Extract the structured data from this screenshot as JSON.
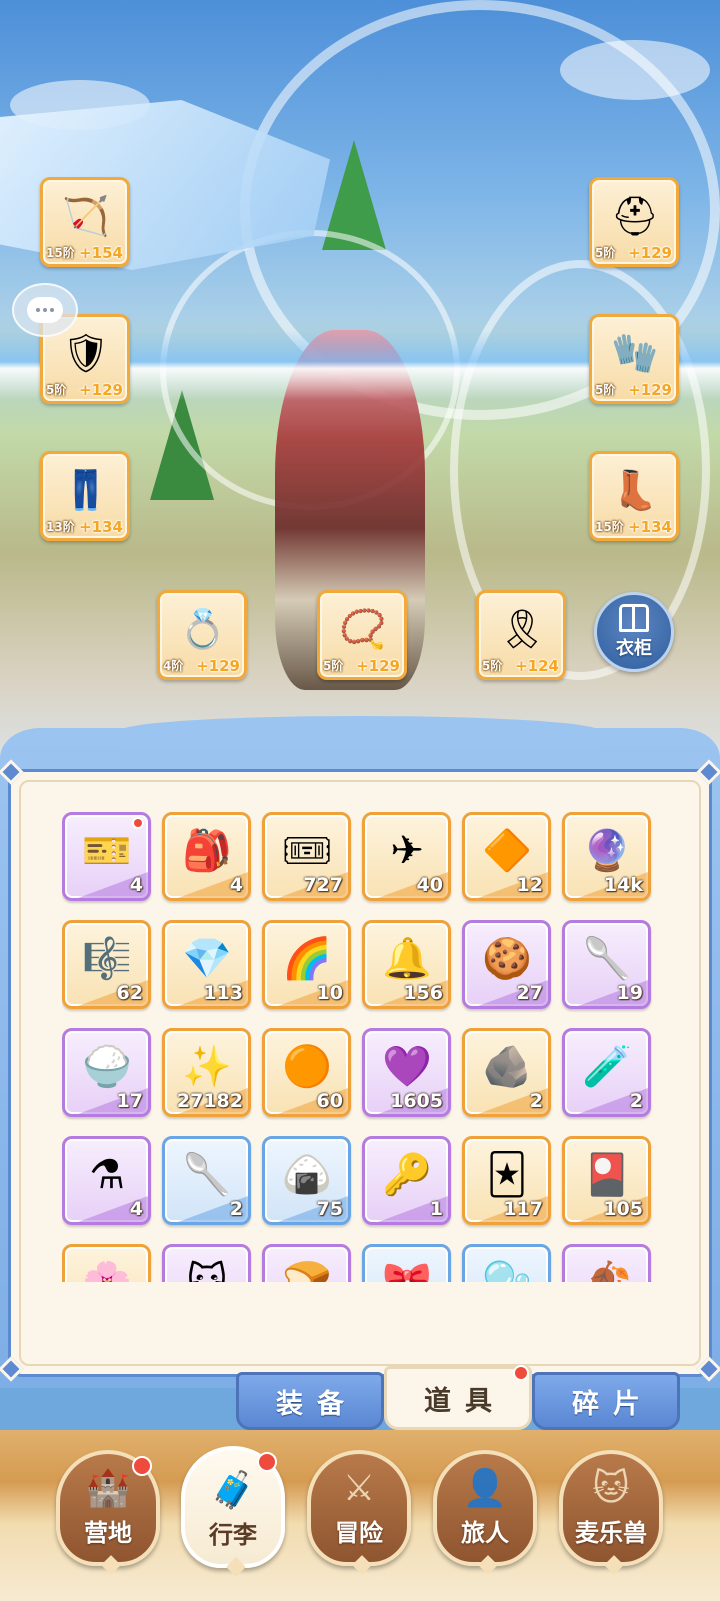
{
  "equipment": [
    {
      "slot": "weapon-bow",
      "icon": "bow-icon",
      "glyph": "🏹",
      "tier": "15阶",
      "bonus": "+154"
    },
    {
      "slot": "chest-armor",
      "icon": "armor-icon",
      "glyph": "🛡",
      "tier": "5阶",
      "bonus": "+129"
    },
    {
      "slot": "legs",
      "icon": "pants-icon",
      "glyph": "👖",
      "tier": "13阶",
      "bonus": "+134"
    },
    {
      "slot": "helmet",
      "icon": "helmet-icon",
      "glyph": "⛑",
      "tier": "5阶",
      "bonus": "+129"
    },
    {
      "slot": "gloves",
      "icon": "gloves-icon",
      "glyph": "🧤",
      "tier": "5阶",
      "bonus": "+129"
    },
    {
      "slot": "boots",
      "icon": "boots-icon",
      "glyph": "👢",
      "tier": "15阶",
      "bonus": "+134"
    },
    {
      "slot": "ring",
      "icon": "ring-icon",
      "glyph": "💍",
      "tier": "4阶",
      "bonus": "+129"
    },
    {
      "slot": "necklace",
      "icon": "necklace-icon",
      "glyph": "📿",
      "tier": "5阶",
      "bonus": "+129"
    },
    {
      "slot": "charm",
      "icon": "charm-icon",
      "glyph": "🎗",
      "tier": "5阶",
      "bonus": "+124"
    }
  ],
  "wardrobe": {
    "label": "衣柜"
  },
  "inventory": {
    "items": [
      {
        "icon": "ticket-card-icon",
        "glyph": "🎫",
        "count": "4",
        "rarity": "purple",
        "new": true
      },
      {
        "icon": "seed-bag-icon",
        "glyph": "🎒",
        "count": "4",
        "rarity": "orange",
        "new": false
      },
      {
        "icon": "purple-ticket-icon",
        "glyph": "🎟",
        "count": "727",
        "rarity": "orange",
        "new": false
      },
      {
        "icon": "paper-plane-icon",
        "glyph": "✈",
        "count": "40",
        "rarity": "orange",
        "new": false
      },
      {
        "icon": "gold-crystal-icon",
        "glyph": "🔶",
        "count": "12",
        "rarity": "orange",
        "new": false
      },
      {
        "icon": "orb-icon",
        "glyph": "🔮",
        "count": "14k",
        "rarity": "orange",
        "new": false
      },
      {
        "icon": "harp-icon",
        "glyph": "🎼",
        "count": "62",
        "rarity": "orange",
        "new": false
      },
      {
        "icon": "ice-crystal-icon",
        "glyph": "💎",
        "count": "113",
        "rarity": "orange",
        "new": false
      },
      {
        "icon": "rainbow-tube-icon",
        "glyph": "🌈",
        "count": "10",
        "rarity": "orange",
        "new": false
      },
      {
        "icon": "bell-icon",
        "glyph": "🔔",
        "count": "156",
        "rarity": "orange",
        "new": false
      },
      {
        "icon": "cookie-plate-icon",
        "glyph": "🍪",
        "count": "27",
        "rarity": "purple",
        "new": false
      },
      {
        "icon": "cat-spoon-icon",
        "glyph": "🥄",
        "count": "19",
        "rarity": "purple",
        "new": false
      },
      {
        "icon": "flour-sack-icon",
        "glyph": "🍚",
        "count": "17",
        "rarity": "purple",
        "new": false
      },
      {
        "icon": "star-crystal-icon",
        "glyph": "✨",
        "count": "27182",
        "rarity": "orange",
        "new": false
      },
      {
        "icon": "amber-gem-icon",
        "glyph": "🟠",
        "count": "60",
        "rarity": "orange",
        "new": false
      },
      {
        "icon": "heart-coin-icon",
        "glyph": "💜",
        "count": "1605",
        "rarity": "purple",
        "new": false
      },
      {
        "icon": "ore-icon",
        "glyph": "🪨",
        "count": "2",
        "rarity": "orange",
        "new": false
      },
      {
        "icon": "blue-potion-icon",
        "glyph": "🧪",
        "count": "2",
        "rarity": "purple",
        "new": false
      },
      {
        "icon": "red-potion-icon",
        "glyph": "⚗",
        "count": "4",
        "rarity": "purple",
        "new": false
      },
      {
        "icon": "paw-spoon-icon",
        "glyph": "🥄",
        "count": "2",
        "rarity": "blue",
        "new": false
      },
      {
        "icon": "rice-bowl-icon",
        "glyph": "🍙",
        "count": "75",
        "rarity": "blue",
        "new": false
      },
      {
        "icon": "gold-key-icon",
        "glyph": "🔑",
        "count": "1",
        "rarity": "purple",
        "new": false
      },
      {
        "icon": "gold-card-icon",
        "glyph": "🃏",
        "count": "117",
        "rarity": "orange",
        "new": false
      },
      {
        "icon": "red-card-icon",
        "glyph": "🎴",
        "count": "105",
        "rarity": "orange",
        "new": false
      },
      {
        "icon": "pink-item-icon",
        "glyph": "🌸",
        "count": "",
        "rarity": "orange",
        "new": false
      },
      {
        "icon": "cat-mask-icon",
        "glyph": "🐱",
        "count": "",
        "rarity": "purple",
        "new": false
      },
      {
        "icon": "bread-icon",
        "glyph": "🍞",
        "count": "",
        "rarity": "purple",
        "new": false
      },
      {
        "icon": "bow-gift-icon",
        "glyph": "🎀",
        "count": "",
        "rarity": "blue",
        "new": false
      },
      {
        "icon": "bubble-icon",
        "glyph": "🫧",
        "count": "",
        "rarity": "blue",
        "new": false
      },
      {
        "icon": "gold-leaf-icon",
        "glyph": "🍂",
        "count": "",
        "rarity": "purple",
        "new": false
      }
    ]
  },
  "subtabs": {
    "equip": "装备",
    "items": "道具",
    "fragments": "碎片"
  },
  "nav": {
    "camp": {
      "label": "营地",
      "icon": "castle-icon",
      "glyph": "🏰"
    },
    "bag": {
      "label": "行李",
      "icon": "backpack-icon",
      "glyph": "🧳"
    },
    "adventure": {
      "label": "冒险",
      "icon": "crossed-swords-icon",
      "glyph": "⚔"
    },
    "traveler": {
      "label": "旅人",
      "icon": "character-icon",
      "glyph": "👤"
    },
    "pets": {
      "label": "麦乐兽",
      "icon": "cat-face-icon",
      "glyph": "🐱"
    }
  },
  "colors": {
    "orange_border": "#f0a23a",
    "purple_border": "#b57be0",
    "blue_border": "#6aa6e6",
    "panel_blue": "#5e8ad1",
    "badge_red": "#ef4b3c"
  }
}
